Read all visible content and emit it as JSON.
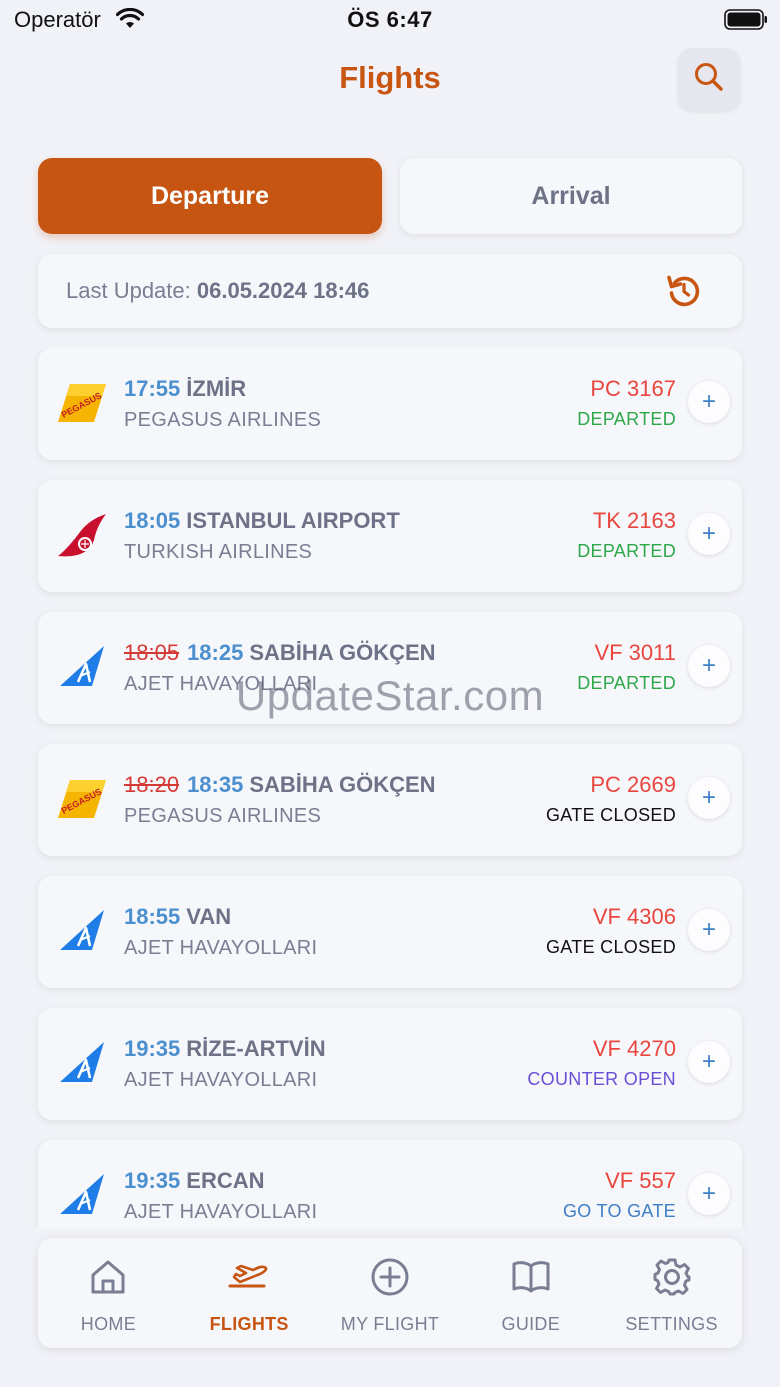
{
  "status_bar": {
    "carrier": "Operatör",
    "time": "ÖS 6:47"
  },
  "header": {
    "title": "Flights"
  },
  "tabs": [
    {
      "label": "Departure",
      "active": true
    },
    {
      "label": "Arrival",
      "active": false
    }
  ],
  "update": {
    "label": "Last Update:",
    "value": "06.05.2024 18:46"
  },
  "flights": [
    {
      "airline_icon": "pegasus-logo",
      "old_time": "",
      "time": "17:55",
      "destination": "İZMİR",
      "airline": "PEGASUS AIRLINES",
      "flight_no": "PC 3167",
      "status": "DEPARTED",
      "status_color": "#2ea84a"
    },
    {
      "airline_icon": "turkish-airlines-logo",
      "old_time": "",
      "time": "18:05",
      "destination": "ISTANBUL AIRPORT",
      "airline": "TURKISH AIRLINES",
      "flight_no": "TK 2163",
      "status": "DEPARTED",
      "status_color": "#2ea84a"
    },
    {
      "airline_icon": "ajet-logo",
      "old_time": "18:05",
      "time": "18:25",
      "destination": "SABİHA GÖKÇEN",
      "airline": "AJET HAVAYOLLARI",
      "flight_no": "VF 3011",
      "status": "DEPARTED",
      "status_color": "#2ea84a"
    },
    {
      "airline_icon": "pegasus-logo",
      "old_time": "18:20",
      "time": "18:35",
      "destination": "SABİHA GÖKÇEN",
      "airline": "PEGASUS AIRLINES",
      "flight_no": "PC 2669",
      "status": "GATE CLOSED",
      "status_color": "#111111"
    },
    {
      "airline_icon": "ajet-logo",
      "old_time": "",
      "time": "18:55",
      "destination": "VAN",
      "airline": "AJET HAVAYOLLARI",
      "flight_no": "VF 4306",
      "status": "GATE CLOSED",
      "status_color": "#111111"
    },
    {
      "airline_icon": "ajet-logo",
      "old_time": "",
      "time": "19:35",
      "destination": "RİZE-ARTVİN",
      "airline": "AJET HAVAYOLLARI",
      "flight_no": "VF 4270",
      "status": "COUNTER OPEN",
      "status_color": "#6a4fd6"
    },
    {
      "airline_icon": "ajet-logo",
      "old_time": "",
      "time": "19:35",
      "destination": "ERCAN",
      "airline": "AJET HAVAYOLLARI",
      "flight_no": "VF 557",
      "status": "GO TO GATE",
      "status_color": "#3f7fc7"
    }
  ],
  "add_label": "+",
  "watermark": "UpdateStar.com",
  "nav": [
    {
      "label": "HOME",
      "icon": "home-icon",
      "active": false
    },
    {
      "label": "FLIGHTS",
      "icon": "plane-icon",
      "active": true
    },
    {
      "label": "MY FLIGHT",
      "icon": "add-circle-icon",
      "active": false
    },
    {
      "label": "GUIDE",
      "icon": "book-icon",
      "active": false
    },
    {
      "label": "SETTINGS",
      "icon": "gear-icon",
      "active": false
    }
  ],
  "colors": {
    "accent": "#c85512",
    "time_blue": "#4b8fcf",
    "flight_no_red": "#e8463e"
  }
}
